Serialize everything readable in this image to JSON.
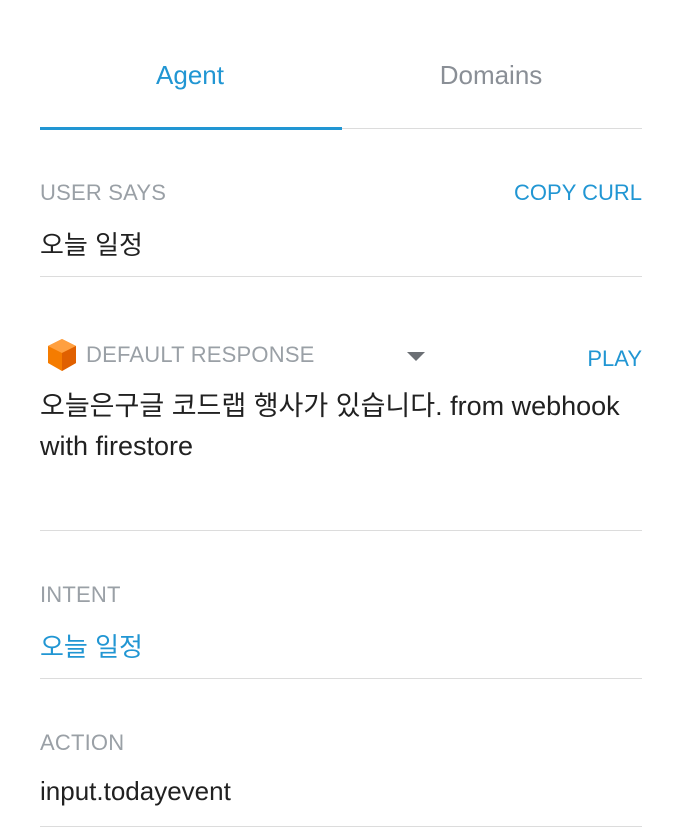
{
  "tabs": [
    {
      "label": "Agent"
    },
    {
      "label": "Domains"
    }
  ],
  "user_says": {
    "label": "USER SAYS",
    "copy_label": "COPY CURL",
    "value": "오늘 일정"
  },
  "response": {
    "label": "DEFAULT RESPONSE",
    "icon": "cube-icon",
    "play_label": "PLAY",
    "text": "오늘은구글 코드랩 행사가 있습니다. from webhook with firestore"
  },
  "intent": {
    "label": "INTENT",
    "value": "오늘 일정"
  },
  "action": {
    "label": "ACTION",
    "value": "input.todayevent"
  },
  "colors": {
    "accent": "#2196d3",
    "muted": "#9aa0a6",
    "cube": "#f57c00"
  }
}
